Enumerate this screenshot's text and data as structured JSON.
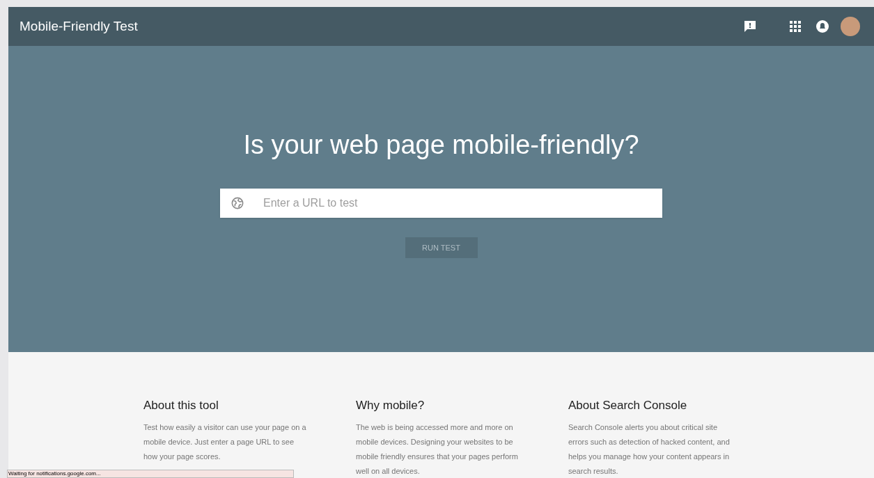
{
  "header": {
    "title": "Mobile-Friendly Test"
  },
  "hero": {
    "heading": "Is your web page mobile-friendly?",
    "url_field": {
      "placeholder": "Enter a URL to test"
    },
    "run_button": {
      "label": "RUN TEST",
      "disabled": true
    }
  },
  "info_columns": [
    {
      "title": "About this tool",
      "body": "Test how easily a visitor can use your page on a mobile device. Just enter a page URL to see how your page scores."
    },
    {
      "title": "Why mobile?",
      "body": "The web is being accessed more and more on mobile devices. Designing your websites to be mobile friendly ensures that your pages perform well on all devices."
    },
    {
      "title": "About Search Console",
      "body": "Search Console alerts you about critical site errors such as detection of hacked content, and helps you manage how your content appears in search results."
    }
  ],
  "status_bar": {
    "text": "Waiting for notifications.google.com..."
  }
}
